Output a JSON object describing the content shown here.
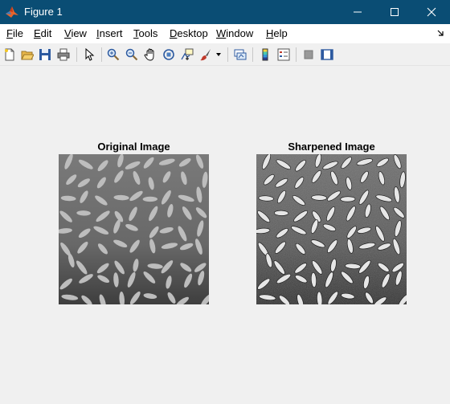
{
  "window": {
    "title": "Figure 1"
  },
  "menu": [
    {
      "mnemonic": "F",
      "rest": "ile"
    },
    {
      "mnemonic": "E",
      "rest": "dit"
    },
    {
      "mnemonic": "V",
      "rest": "iew"
    },
    {
      "mnemonic": "I",
      "rest": "nsert"
    },
    {
      "mnemonic": "T",
      "rest": "ools"
    },
    {
      "mnemonic": "D",
      "rest": "esktop"
    },
    {
      "mnemonic": "W",
      "rest": "indow"
    },
    {
      "mnemonic": "H",
      "rest": "elp"
    }
  ],
  "toolbar": {
    "buttons": [
      "new-figure-icon",
      "open-file-icon",
      "save-icon",
      "print-icon",
      "select-arrow-icon",
      "zoom-in-icon",
      "zoom-out-icon",
      "pan-hand-icon",
      "rotate-3d-icon",
      "data-cursor-icon",
      "brush-icon",
      "link-plot-icon",
      "colorbar-icon",
      "legend-icon",
      "hide-plot-tools-icon",
      "show-plot-tools-icon"
    ]
  },
  "axes": [
    {
      "title": "Original Image",
      "image": "grayscale rice grains image"
    },
    {
      "title": "Sharpened Image",
      "image": "sharpened grayscale rice grains image"
    }
  ],
  "colors": {
    "titlebar": "#0a4d74",
    "background": "#f0f0f0",
    "menubar": "#ffffff"
  }
}
